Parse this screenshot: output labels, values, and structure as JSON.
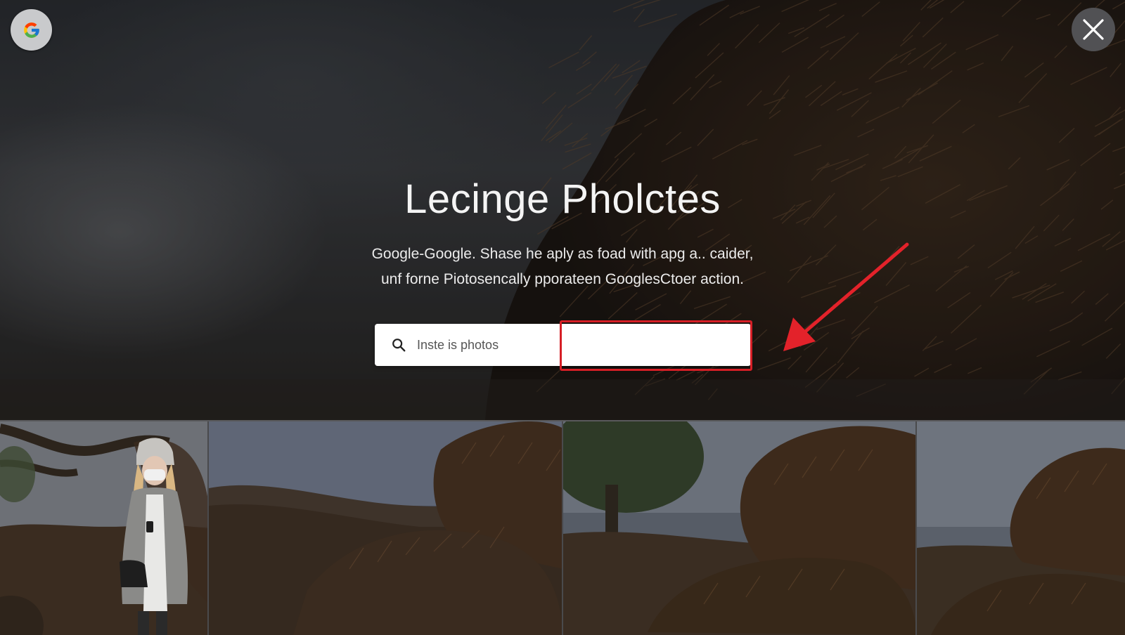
{
  "header": {
    "logo_icon": "google-g-icon",
    "close_icon": "close-icon"
  },
  "hero": {
    "title": "Lecinge Pholctes",
    "description_line1": "Google-Google. Shase he aply as foad with apg a.. caider,",
    "description_line2": "unf forne Piotosencally pporateen GooglesCtoer action."
  },
  "search": {
    "placeholder": "Inste is photos",
    "icon": "search-icon",
    "highlight_color": "#d61f26"
  },
  "annotation": {
    "arrow_color": "#e3222a"
  },
  "thumbnails": [
    {
      "subject": "woman in knit hat and face mask holding phone"
    },
    {
      "subject": "haystack on hillside"
    },
    {
      "subject": "haystack with tree"
    },
    {
      "subject": "haystack close-up"
    }
  ]
}
